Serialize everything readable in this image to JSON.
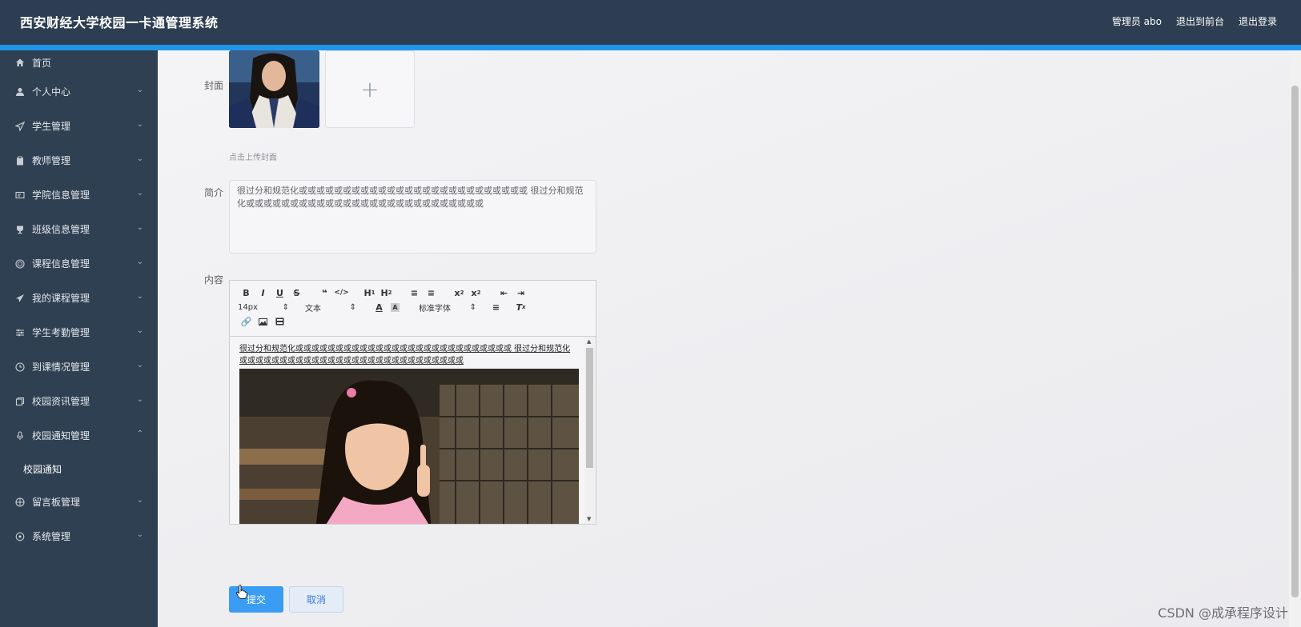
{
  "header": {
    "title": "西安财经大学校园一卡通管理系统",
    "user": "管理员 abo",
    "back_front": "退出到前台",
    "logout": "退出登录"
  },
  "sidebar": {
    "items": [
      {
        "label": "首页",
        "icon": "home-icon",
        "expanded": null
      },
      {
        "label": "个人中心",
        "icon": "user-icon",
        "expanded": false
      },
      {
        "label": "学生管理",
        "icon": "send-icon",
        "expanded": false
      },
      {
        "label": "教师管理",
        "icon": "clipboard-icon",
        "expanded": false
      },
      {
        "label": "学院信息管理",
        "icon": "card-icon",
        "expanded": false
      },
      {
        "label": "班级信息管理",
        "icon": "cup-icon",
        "expanded": false
      },
      {
        "label": "课程信息管理",
        "icon": "target-icon",
        "expanded": false
      },
      {
        "label": "我的课程管理",
        "icon": "paper-plane-icon",
        "expanded": false
      },
      {
        "label": "学生考勤管理",
        "icon": "sliders-icon",
        "expanded": false
      },
      {
        "label": "到课情况管理",
        "icon": "clock-icon",
        "expanded": false
      },
      {
        "label": "校园资讯管理",
        "icon": "copy-icon",
        "expanded": false
      },
      {
        "label": "校园通知管理",
        "icon": "microphone-icon",
        "expanded": true
      },
      {
        "label": "留言板管理",
        "icon": "basketball-icon",
        "expanded": false
      },
      {
        "label": "系统管理",
        "icon": "settings-icon",
        "expanded": false
      }
    ],
    "sub_item": "校园通知"
  },
  "form": {
    "cover_label": "封面",
    "upload_tip": "点击上传封面",
    "intro_label": "简介",
    "intro_value": " 很过分和规范化或或或或或或或或或或或或或或或或或或或或或或或或或或 很过分和规范化或或或或或或或或或或或或或或或或或或或或或或或或或或或",
    "content_label": "内容",
    "editor": {
      "font_size": "14px",
      "block_type": "文本",
      "font_family": "标准字体",
      "text": " 很过分和规范化或或或或或或或或或或或或或或或或或或或或或或或或或或或 很过分和规范化或或或或或或或或或或或或或或或或或或或或或或或或或或或或"
    },
    "submit": "提交",
    "cancel": "取消"
  },
  "watermark": "CSDN @成承程序设计"
}
